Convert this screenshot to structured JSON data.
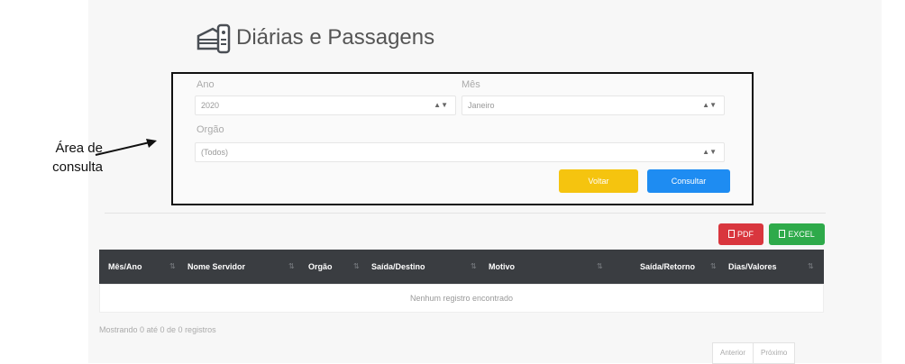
{
  "annotation": {
    "line1": "Área de",
    "line2": "consulta"
  },
  "header": {
    "title": "Diárias e Passagens",
    "icon": "money-bag-and-card-icon"
  },
  "form": {
    "ano_label": "Ano",
    "ano_value": "2020",
    "mes_label": "Mês",
    "mes_value": "Janeiro",
    "orgao_label": "Orgão",
    "orgao_value": "(Todos)",
    "voltar_label": "Voltar",
    "consultar_label": "Consultar"
  },
  "export": {
    "pdf_label": "PDF",
    "excel_label": "EXCEL"
  },
  "table": {
    "columns": [
      "Mês/Ano",
      "Nome Servidor",
      "Orgão",
      "Saída/Destino",
      "Motivo",
      "Saída/Retorno",
      "Dias/Valores"
    ],
    "empty_text": "Nenhum registro encontrado"
  },
  "info_text": "Mostrando 0 até 0 de 0 registros",
  "pagination": {
    "prev_label": "Anterior",
    "next_label": "Próximo"
  },
  "colors": {
    "voltar": "#f5c40f",
    "consultar": "#1e8cf2",
    "pdf": "#d9363e",
    "excel": "#2eaa4a",
    "table_header": "#3a3d41"
  }
}
